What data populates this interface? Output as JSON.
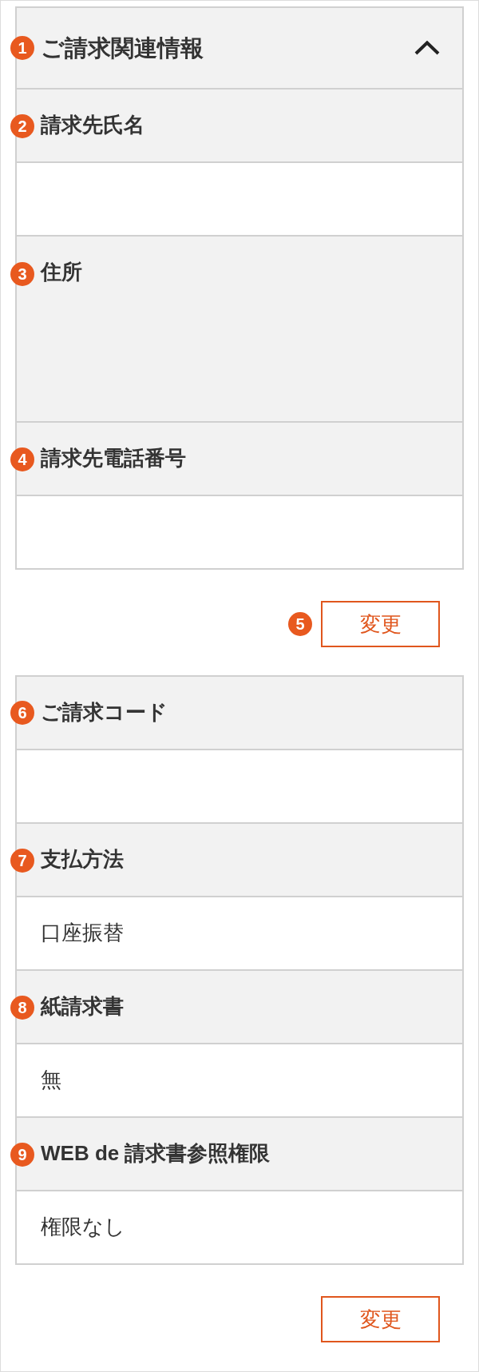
{
  "sections": [
    {
      "kind": "collapsible",
      "title": "ご請求関連情報",
      "badge": "1",
      "expanded": true,
      "fields": [
        {
          "kind": "row",
          "badge": "2",
          "label": "請求先氏名"
        },
        {
          "kind": "block",
          "badge": "3",
          "label": "住所"
        },
        {
          "kind": "row",
          "badge": "4",
          "label": "請求先電話番号"
        }
      ],
      "button": {
        "label": "変更",
        "badge": "5"
      }
    },
    {
      "kind": "plain",
      "fields": [
        {
          "kind": "row",
          "badge": "6",
          "label": "ご請求コード"
        },
        {
          "kind": "row",
          "badge": "7",
          "label": "支払方法",
          "value": "口座振替"
        },
        {
          "kind": "row",
          "badge": "8",
          "label": "紙請求書",
          "value": "無"
        },
        {
          "kind": "row",
          "badge": "9",
          "label": "WEB de 請求書参照権限",
          "value": "権限なし"
        }
      ],
      "button": {
        "label": "変更"
      }
    }
  ]
}
